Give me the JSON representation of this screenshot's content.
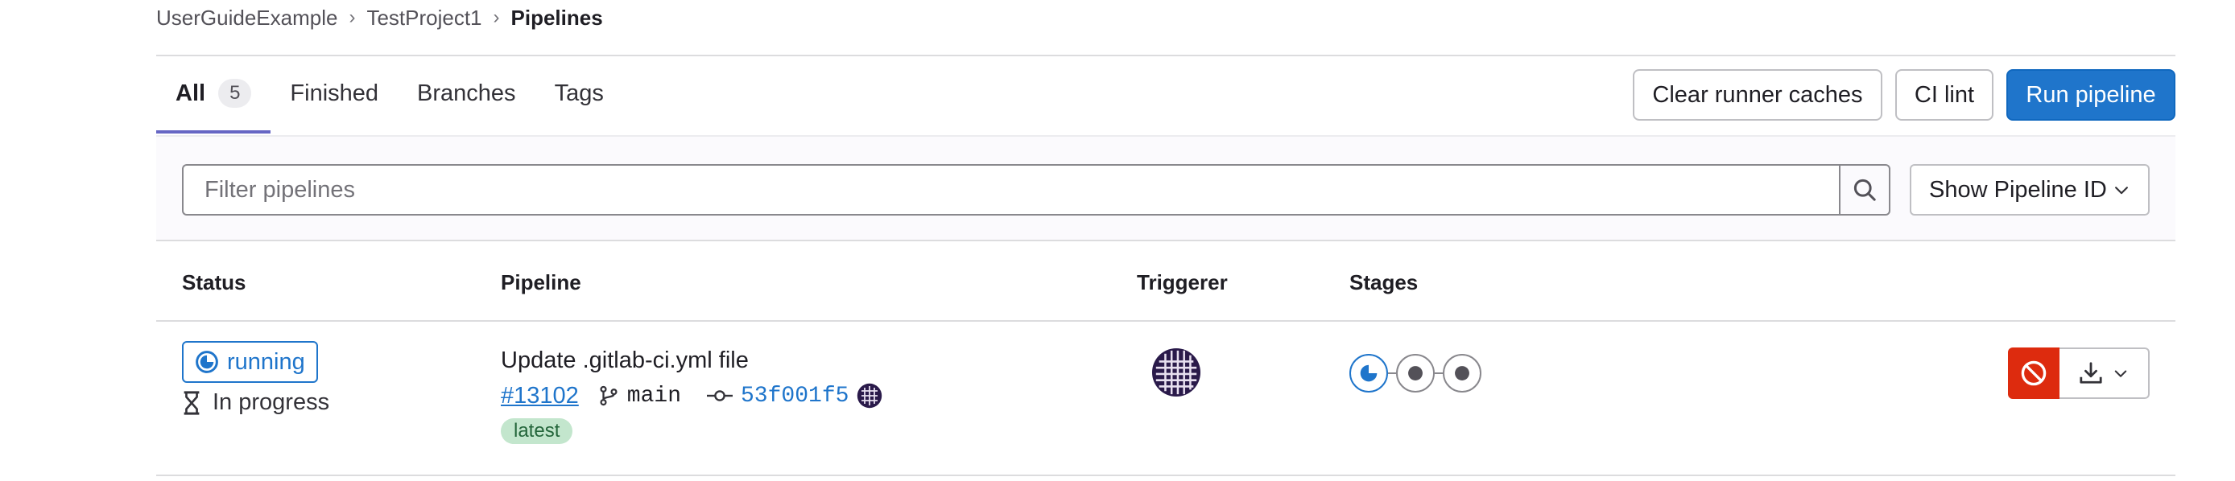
{
  "breadcrumb": {
    "items": [
      "UserGuideExample",
      "TestProject1",
      "Pipelines"
    ]
  },
  "tabs": [
    {
      "label": "All",
      "count": "5",
      "active": true
    },
    {
      "label": "Finished"
    },
    {
      "label": "Branches"
    },
    {
      "label": "Tags"
    }
  ],
  "actions": {
    "clear_caches": "Clear runner caches",
    "ci_lint": "CI lint",
    "run_pipeline": "Run pipeline"
  },
  "filter": {
    "placeholder": "Filter pipelines",
    "select_label": "Show Pipeline ID"
  },
  "table": {
    "headers": {
      "status": "Status",
      "pipeline": "Pipeline",
      "triggerer": "Triggerer",
      "stages": "Stages"
    },
    "rows": [
      {
        "status": "running",
        "duration_text": "In progress",
        "commit_title": "Update .gitlab-ci.yml file",
        "pipeline_id": "#13102",
        "branch": "main",
        "sha": "53f001f5",
        "badge": "latest",
        "stages": [
          "running",
          "created",
          "created"
        ]
      }
    ]
  },
  "colors": {
    "primary": "#1f75cb",
    "danger": "#dd2b0e",
    "tab_active": "#6666c4",
    "badge_latest_bg": "#c3e6cd"
  },
  "icons": {
    "breadcrumb_separator": "chevron-right-icon",
    "search": "search-icon",
    "select": "chevron-down-icon",
    "status": "status-running-icon",
    "duration": "hourglass-icon",
    "branch": "branch-icon",
    "commit": "commit-icon",
    "cancel": "cancel-icon",
    "download": "download-icon"
  }
}
